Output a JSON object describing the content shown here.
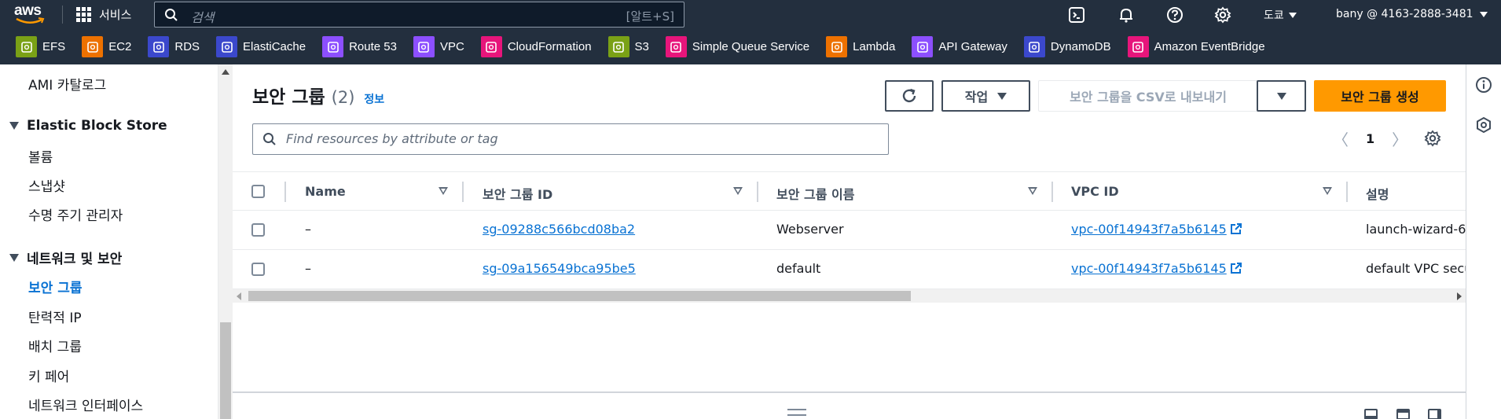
{
  "topnav": {
    "logo": "aws",
    "services_label": "서비스",
    "search_placeholder": "검색",
    "search_shortcut": "[알트+S]",
    "region": "도쿄",
    "account": "bany @ 4163-2888-3481",
    "icons": [
      "cloudshell-icon",
      "notifications-bell-icon",
      "help-icon",
      "settings-gear-icon"
    ]
  },
  "favorites": [
    {
      "label": "EFS",
      "color": "#7aa116"
    },
    {
      "label": "EC2",
      "color": "#ed7100"
    },
    {
      "label": "RDS",
      "color": "#3b48cc"
    },
    {
      "label": "ElastiCache",
      "color": "#3b48cc"
    },
    {
      "label": "Route 53",
      "color": "#8c4fff"
    },
    {
      "label": "VPC",
      "color": "#8c4fff"
    },
    {
      "label": "CloudFormation",
      "color": "#e7157b"
    },
    {
      "label": "S3",
      "color": "#7aa116"
    },
    {
      "label": "Simple Queue Service",
      "color": "#e7157b"
    },
    {
      "label": "Lambda",
      "color": "#ed7100"
    },
    {
      "label": "API Gateway",
      "color": "#8c4fff"
    },
    {
      "label": "DynamoDB",
      "color": "#3b48cc"
    },
    {
      "label": "Amazon EventBridge",
      "color": "#e7157b"
    }
  ],
  "sidebar": {
    "ami_catalog": "AMI 카탈로그",
    "ebs_section": "Elastic Block Store",
    "ebs_items": [
      "볼륨",
      "스냅샷",
      "수명 주기 관리자"
    ],
    "net_section": "네트워크 및 보안",
    "net_items": [
      "보안 그룹",
      "탄력적 IP",
      "배치 그룹",
      "키 페어",
      "네트워크 인터페이스"
    ],
    "active_item": "보안 그룹"
  },
  "main": {
    "title": "보안 그룹",
    "count": "(2)",
    "info_link": "정보",
    "actions_label": "작업",
    "export_label": "보안 그룹을 CSV로 내보내기",
    "create_label": "보안 그룹 생성",
    "filter_placeholder": "Find resources by attribute or tag",
    "page_number": "1",
    "prev_glyph": "〈",
    "next_glyph": "〉"
  },
  "table": {
    "columns": [
      "Name",
      "보안 그룹 ID",
      "보안 그룹 이름",
      "VPC ID",
      "설명"
    ],
    "rows": [
      {
        "name": "–",
        "sg_id": "sg-09288c566bcd08ba2",
        "sg_name": "Webserver",
        "vpc_id": "vpc-00f14943f7a5b6145",
        "desc": "launch-wizard-6"
      },
      {
        "name": "–",
        "sg_id": "sg-09a156549bca95be5",
        "sg_name": "default",
        "vpc_id": "vpc-00f14943f7a5b6145",
        "desc": "default VPC secu"
      }
    ]
  },
  "colors": {
    "nav_bg": "#232f3e",
    "link": "#0972d3",
    "primary_button": "#ff9900"
  }
}
